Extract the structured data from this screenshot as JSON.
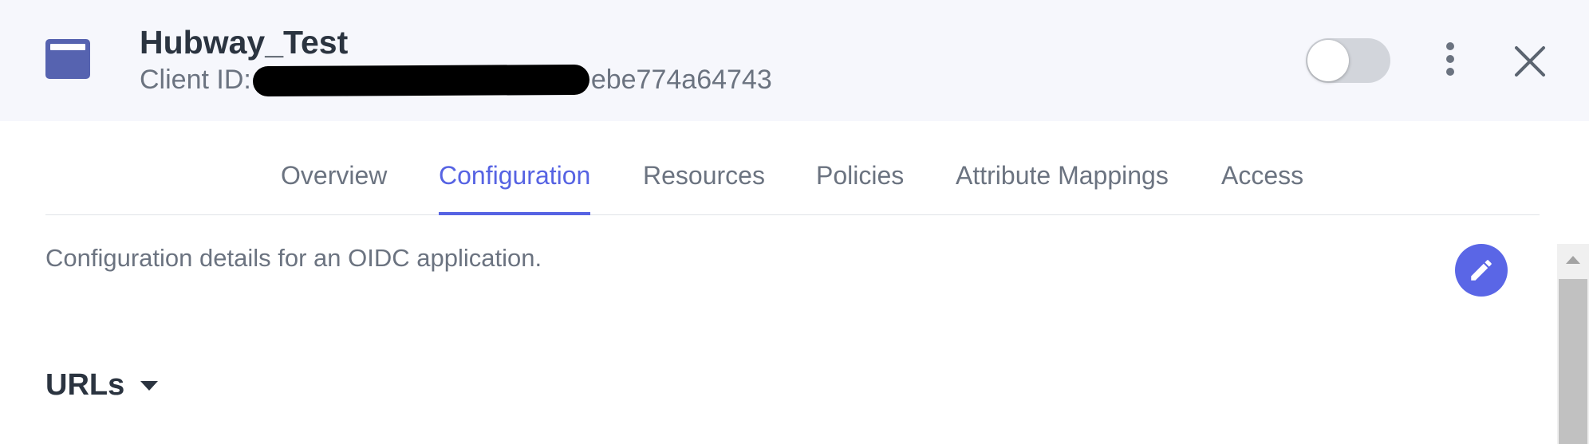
{
  "header": {
    "title": "Hubway_Test",
    "client_id_label": "Client ID:",
    "client_id_suffix": "ebe774a64743",
    "icons": {
      "app": "application-window-icon",
      "more": "kebab-menu-icon",
      "close": "close-icon"
    }
  },
  "tabs": [
    {
      "label": "Overview",
      "active": false
    },
    {
      "label": "Configuration",
      "active": true
    },
    {
      "label": "Resources",
      "active": false
    },
    {
      "label": "Policies",
      "active": false
    },
    {
      "label": "Attribute Mappings",
      "active": false
    },
    {
      "label": "Access",
      "active": false
    }
  ],
  "main": {
    "description": "Configuration details for an OIDC application.",
    "edit_icon": "pencil-icon",
    "section_title": "URLs"
  },
  "colors": {
    "accent": "#5663e3",
    "header_bg": "#f6f7fc",
    "app_icon": "#5663b0",
    "toggle_off": "#d2d5db"
  }
}
